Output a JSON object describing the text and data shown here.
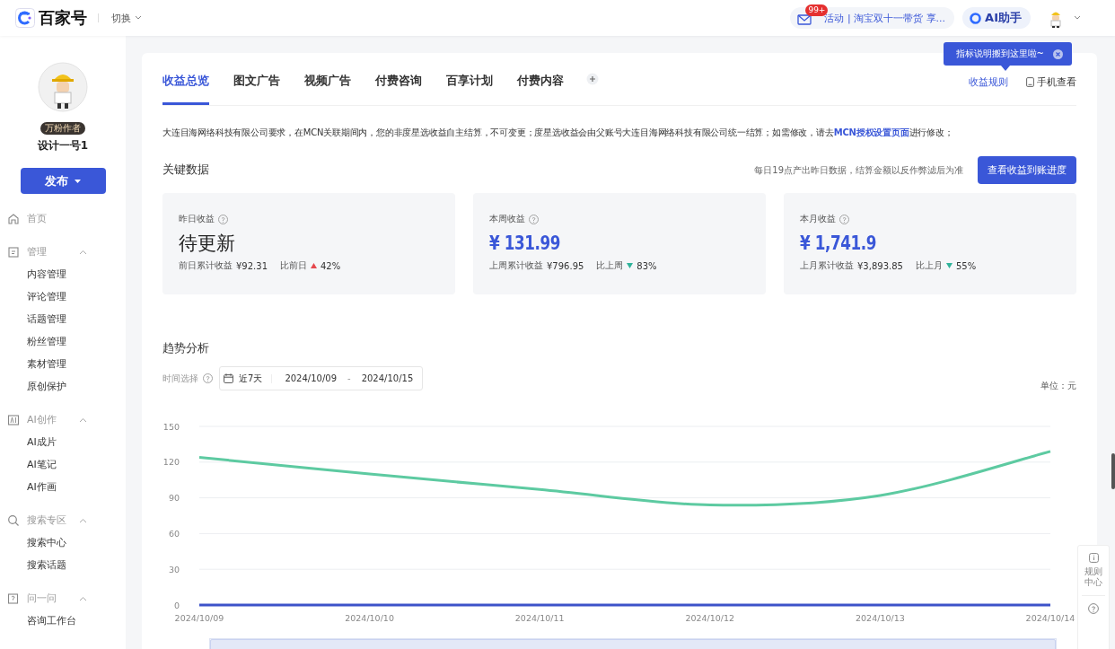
{
  "topbar": {
    "brand": "百家号",
    "switch_label": "切换",
    "notice_badge": "99+",
    "notice_text": "活动 | 淘宝双十一带货 享...",
    "assistant_label": "AI助手"
  },
  "sidebar": {
    "author_badge": "万粉作者",
    "author_name": "设计一号1",
    "publish_label": "发布",
    "nav": [
      {
        "label": "首页"
      },
      {
        "label": "管理",
        "expanded": true,
        "children": [
          {
            "label": "内容管理"
          },
          {
            "label": "评论管理"
          },
          {
            "label": "话题管理"
          },
          {
            "label": "粉丝管理"
          },
          {
            "label": "素材管理"
          },
          {
            "label": "原创保护"
          }
        ]
      },
      {
        "label": "AI创作",
        "expanded": true,
        "children": [
          {
            "label": "AI成片"
          },
          {
            "label": "AI笔记"
          },
          {
            "label": "AI作画"
          }
        ]
      },
      {
        "label": "搜索专区",
        "expanded": true,
        "children": [
          {
            "label": "搜索中心"
          },
          {
            "label": "搜索话题"
          }
        ]
      },
      {
        "label": "问一问",
        "expanded": true,
        "children": [
          {
            "label": "咨询工作台"
          }
        ]
      }
    ]
  },
  "tabs": [
    {
      "label": "收益总览",
      "selected": true
    },
    {
      "label": "图文广告",
      "selected": false
    },
    {
      "label": "视频广告",
      "selected": false
    },
    {
      "label": "付费咨询",
      "selected": false
    },
    {
      "label": "百享计划",
      "selected": false
    },
    {
      "label": "付费内容",
      "selected": false
    }
  ],
  "tab_links": {
    "rules": "收益规则",
    "mobile": "手机查看"
  },
  "tooltip": "指标说明搬到这里啦~",
  "notice": {
    "before": "大连目海网络科技有限公司要求，在MCN关联期间内，您的非度星选收益自主结算，不可变更；度星选收益会由父账号大连目海网络科技有限公司统一结算；如需修改，请去",
    "link": "MCN授权设置页面",
    "after": "进行修改；"
  },
  "key_data": {
    "title": "关键数据",
    "hint": "每日19点产出昨日数据，结算金额以反作弊滤后为准",
    "button": "查看收益到账进度"
  },
  "stats": [
    {
      "label": "昨日收益",
      "kind": "pending",
      "value": "待更新",
      "prev_label": "前日累计收益",
      "prev_value": "¥92.31",
      "compare_label": "比前日",
      "rising": true,
      "change": "42%"
    },
    {
      "label": "本周收益",
      "kind": "amount",
      "value": "¥ 131.99",
      "prev_label": "上周累计收益",
      "prev_value": "¥796.95",
      "compare_label": "比上周",
      "rising": false,
      "change": "83%"
    },
    {
      "label": "本月收益",
      "kind": "amount",
      "value": "¥ 1,741.9",
      "prev_label": "上月累计收益",
      "prev_value": "¥3,893.85",
      "compare_label": "比上月",
      "rising": false,
      "change": "55%"
    }
  ],
  "trend": {
    "title": "趋势分析",
    "time_label": "时间选择",
    "range_preset": "近7天",
    "start_date": "2024/10/09",
    "separator": "-",
    "end_date": "2024/10/15",
    "unit": "单位：元",
    "chart_data": {
      "type": "line",
      "categories": [
        "2024/10/09",
        "2024/10/10",
        "2024/10/11",
        "2024/10/12",
        "2024/10/13",
        "2024/10/14"
      ],
      "ylim": [
        0,
        150
      ],
      "yticks": [
        0,
        30,
        60,
        90,
        120,
        150
      ],
      "grid": true,
      "series": [
        {
          "color": "#5dcaa1",
          "values": [
            124,
            110,
            97,
            84,
            92,
            129
          ]
        },
        {
          "color": "#3d52c9",
          "values": [
            0,
            0,
            0,
            0,
            0,
            0
          ]
        }
      ]
    },
    "zoom": {
      "level": 1
    }
  },
  "side_panel": {
    "rules_center": "规则中心"
  }
}
